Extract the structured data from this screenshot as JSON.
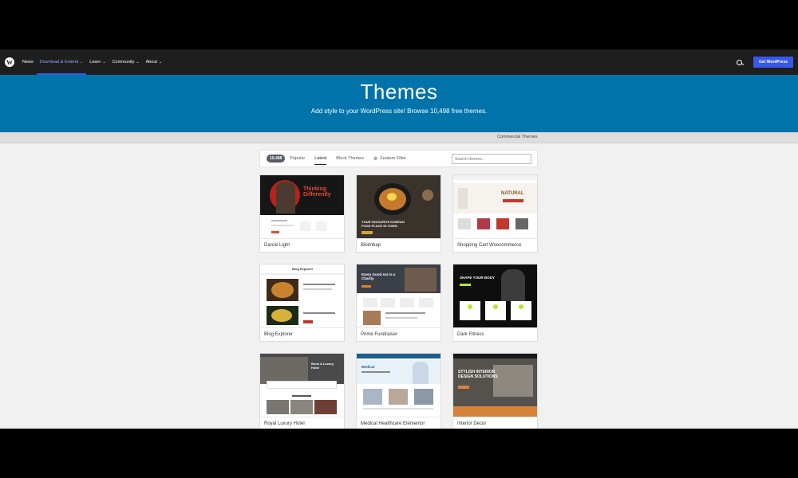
{
  "nav": {
    "items": [
      {
        "label": "News",
        "chevron": false,
        "active": false
      },
      {
        "label": "Download & Extend",
        "chevron": true,
        "active": true
      },
      {
        "label": "Learn",
        "chevron": true,
        "active": false
      },
      {
        "label": "Community",
        "chevron": true,
        "active": false
      },
      {
        "label": "About",
        "chevron": true,
        "active": false
      }
    ],
    "cta": "Get WordPress"
  },
  "hero": {
    "title": "Themes",
    "subtitle": "Add style to your WordPress site! Browse 10,498 free themes."
  },
  "subbar": {
    "link": "Commercial Themes"
  },
  "filters": {
    "count": "10,498",
    "tabs": [
      "Popular",
      "Latest",
      "Block Themes"
    ],
    "active_tab": "Latest",
    "feature_filter": "Feature Filter",
    "search_placeholder": "Search themes..."
  },
  "themes": [
    {
      "name": "Darcie Light",
      "hero_text": "Thinking Differently"
    },
    {
      "name": "Bibimbap",
      "hero_text": "YOUR FAVOURITE KOREAN FOOD PLACE IN TOWN"
    },
    {
      "name": "Shopping Cart Woocommerce",
      "hero_text": "NATURAL"
    },
    {
      "name": "Blog Explorer",
      "hero_text": "Blog Explorer"
    },
    {
      "name": "Prime Fundraiser",
      "hero_text": "Every Good Act is a Charity"
    },
    {
      "name": "Dark Fitness",
      "hero_text": "SHAPE YOUR BODY"
    },
    {
      "name": "Royal Luxury Hotel",
      "hero_text": "Book A Luxury Hotel"
    },
    {
      "name": "Medical Healthcare Elementor",
      "hero_text": "Medical"
    },
    {
      "name": "Interior Decor",
      "hero_text": "STYLISH INTERIOR DESIGN SOLUTIONS"
    }
  ],
  "colors": {
    "hero_bg": "#0073aa",
    "nav_bg": "#1e1e1e",
    "accent": "#3858e9"
  }
}
